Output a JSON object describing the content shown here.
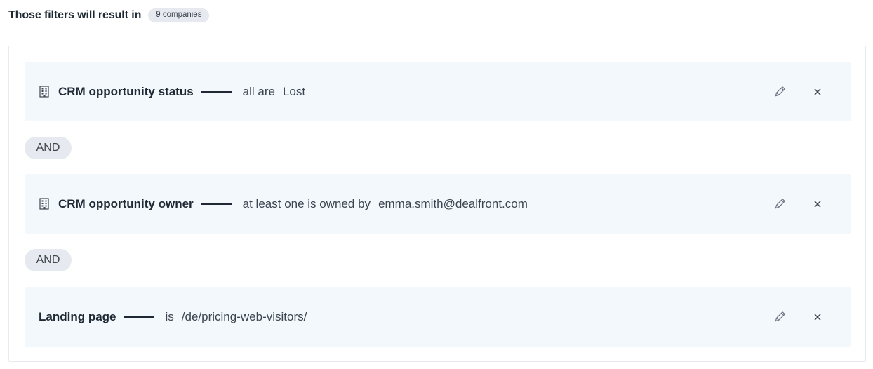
{
  "header": {
    "text": "Those filters will result in",
    "count_label": "9 companies"
  },
  "filters": [
    {
      "has_icon": true,
      "icon": "building-icon",
      "label": "CRM opportunity status",
      "operator": "all are",
      "value": "Lost"
    },
    {
      "has_icon": true,
      "icon": "building-icon",
      "label": "CRM opportunity owner",
      "operator": "at least one is owned by",
      "value": "emma.smith@dealfront.com"
    },
    {
      "has_icon": false,
      "label": "Landing page",
      "operator": "is",
      "value": "/de/pricing-web-visitors/"
    }
  ],
  "joiners": [
    "AND",
    "AND"
  ],
  "actions": {
    "edit_icon": "pencil-icon",
    "remove_icon": "close-icon"
  },
  "colors": {
    "row_background": "#f3f8fd",
    "chip_background": "#e6e9ef",
    "text_primary": "#1f2933",
    "text_secondary": "#3d4550"
  }
}
